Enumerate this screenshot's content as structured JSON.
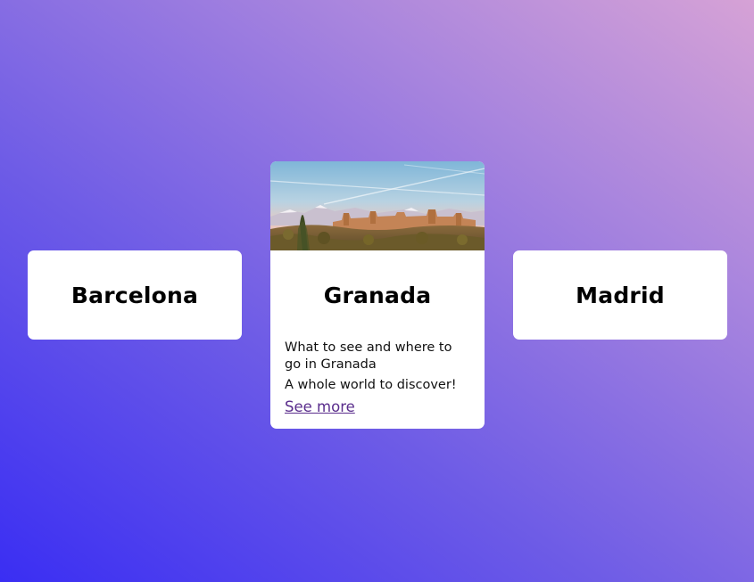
{
  "cards": [
    {
      "title": "Barcelona"
    },
    {
      "title": "Granada",
      "image": "granada-alhambra-photo",
      "description": "What to see and where to go in Granada",
      "tagline": "A whole world to discover!",
      "link_label": "See more"
    },
    {
      "title": "Madrid"
    }
  ],
  "colors": {
    "background_start": "#3a2ef3",
    "background_end": "#d6a2d6",
    "card": "#ffffff",
    "link": "#5a2d8c"
  }
}
